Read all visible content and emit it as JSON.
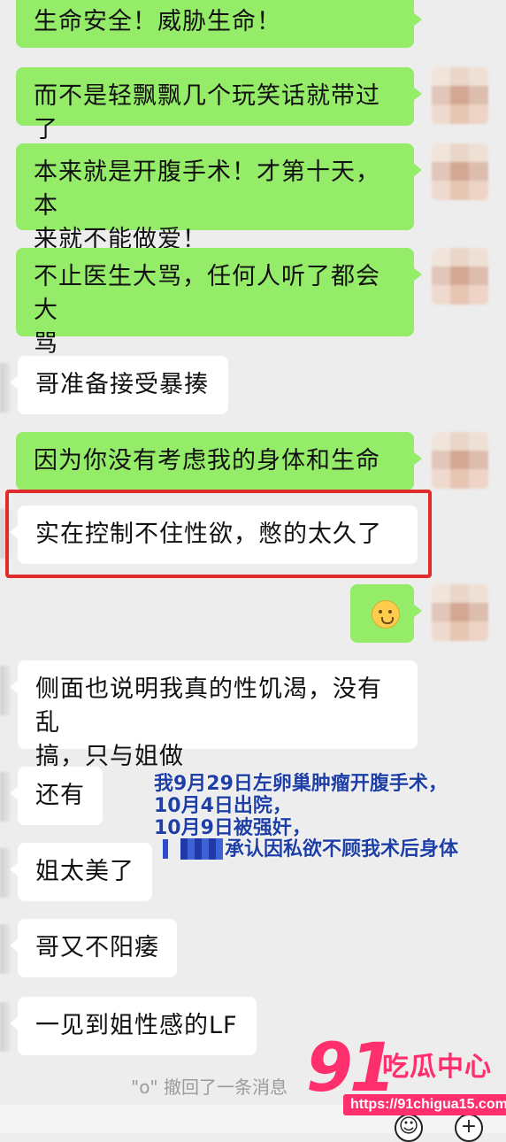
{
  "messages": [
    {
      "side": "right",
      "text": "生命安全！威胁生命！"
    },
    {
      "side": "right",
      "text": "而不是轻飘飘几个玩笑话就带过了"
    },
    {
      "side": "right",
      "lines": [
        "本来就是开腹手术！才第十天，本",
        "来就不能做爱！"
      ]
    },
    {
      "side": "right",
      "lines": [
        "不止医生大骂，任何人听了都会大",
        "骂"
      ]
    },
    {
      "side": "left",
      "text": "哥准备接受暴揍"
    },
    {
      "side": "right",
      "text": "因为你没有考虑我的身体和生命"
    },
    {
      "side": "left",
      "text": "实在控制不住性欲，憋的太久了",
      "highlighted": true
    },
    {
      "side": "right",
      "emoji": "flushed-face-icon"
    },
    {
      "side": "left",
      "lines": [
        "侧面也说明我真的性饥渴，没有乱",
        "搞，只与姐做"
      ]
    },
    {
      "side": "left",
      "text": "还有"
    },
    {
      "side": "left",
      "text": "姐太美了"
    },
    {
      "side": "left",
      "text": "哥又不阳痿"
    },
    {
      "side": "left",
      "text": "一见到姐性感的LF"
    }
  ],
  "annotation": {
    "lines": [
      "我9月29日左卵巢肿瘤开腹手术，",
      "10月4日出院，",
      "10月9日被强奸，",
      "承认因私欲不顾我术后身体"
    ]
  },
  "system": {
    "recall_notice": "\"o\" 撤回了一条消息"
  },
  "watermark": {
    "number": "91",
    "brand": "吃瓜中心",
    "url": "https://91chigua15.com"
  },
  "colors": {
    "sent_bubble": "#95ec69",
    "received_bubble": "#ffffff",
    "chat_background": "#ededed",
    "highlight_border": "#e02c2c",
    "annotation_text": "#1e3fa6",
    "watermark": "#ff2e6c"
  }
}
